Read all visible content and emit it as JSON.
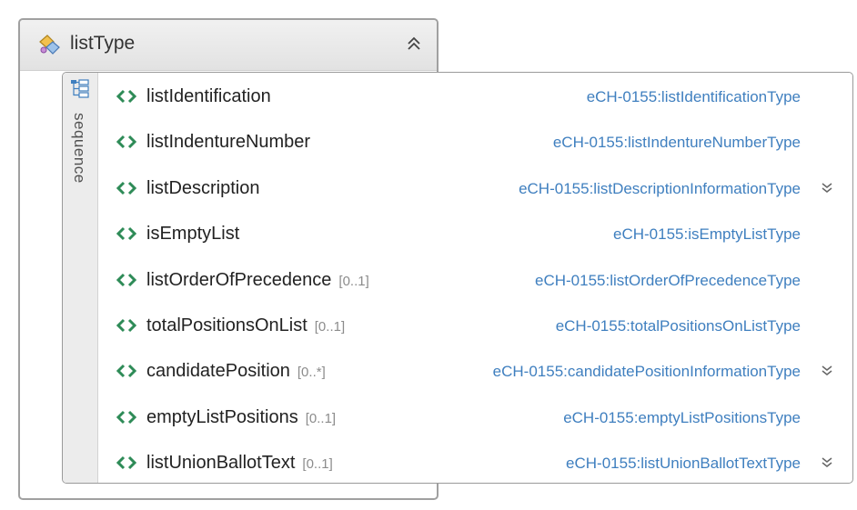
{
  "type": {
    "name": "listType",
    "icon": "complex-type-icon",
    "collapse_icon": "double-chevron-up-icon"
  },
  "sequence": {
    "label": "sequence",
    "icon": "sequence-icon",
    "elements": [
      {
        "name": "listIdentification",
        "cardinality": "",
        "type": "eCH-0155:listIdentificationType",
        "expandable": false
      },
      {
        "name": "listIndentureNumber",
        "cardinality": "",
        "type": "eCH-0155:listIndentureNumberType",
        "expandable": false
      },
      {
        "name": "listDescription",
        "cardinality": "",
        "type": "eCH-0155:listDescriptionInformationType",
        "expandable": true
      },
      {
        "name": "isEmptyList",
        "cardinality": "",
        "type": "eCH-0155:isEmptyListType",
        "expandable": false
      },
      {
        "name": "listOrderOfPrecedence",
        "cardinality": "[0..1]",
        "type": "eCH-0155:listOrderOfPrecedenceType",
        "expandable": false
      },
      {
        "name": "totalPositionsOnList",
        "cardinality": "[0..1]",
        "type": "eCH-0155:totalPositionsOnListType",
        "expandable": false
      },
      {
        "name": "candidatePosition",
        "cardinality": "[0..*]",
        "type": "eCH-0155:candidatePositionInformationType",
        "expandable": true
      },
      {
        "name": "emptyListPositions",
        "cardinality": "[0..1]",
        "type": "eCH-0155:emptyListPositionsType",
        "expandable": false
      },
      {
        "name": "listUnionBallotText",
        "cardinality": "[0..1]",
        "type": "eCH-0155:listUnionBallotTextType",
        "expandable": true
      }
    ]
  },
  "colors": {
    "type_link": "#3f7fbf",
    "element_icon": "#2e8b57"
  }
}
